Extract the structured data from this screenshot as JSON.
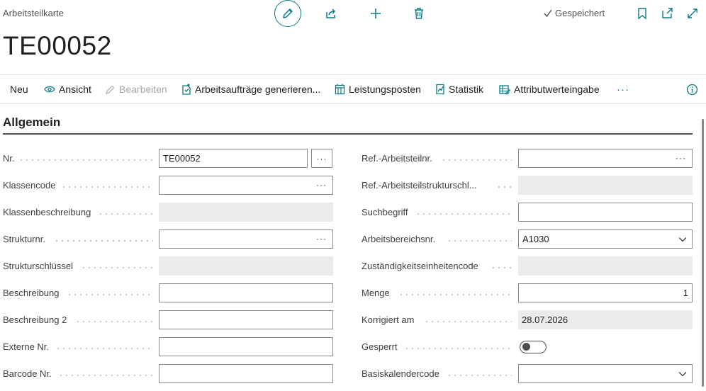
{
  "header": {
    "page_caption": "Arbeitsteilkarte",
    "saved_status": "Gespeichert",
    "record_title": "TE00052"
  },
  "toolbar": {
    "new": "Neu",
    "view": "Ansicht",
    "edit": "Bearbeiten",
    "generate_work_orders": "Arbeitsaufträge generieren...",
    "service_entries": "Leistungsposten",
    "statistics": "Statistik",
    "attribute_entry": "Attributwerteingabe",
    "more": "···"
  },
  "section": {
    "title": "Allgemein"
  },
  "left_fields": [
    {
      "label": "Nr.",
      "value": "TE00052"
    },
    {
      "label": "Klassencode",
      "value": ""
    },
    {
      "label": "Klassenbeschreibung",
      "value": ""
    },
    {
      "label": "Strukturnr.",
      "value": ""
    },
    {
      "label": "Strukturschlüssel",
      "value": ""
    },
    {
      "label": "Beschreibung",
      "value": ""
    },
    {
      "label": "Beschreibung 2",
      "value": ""
    },
    {
      "label": "Externe Nr.",
      "value": ""
    },
    {
      "label": "Barcode Nr.",
      "value": ""
    }
  ],
  "right_fields": [
    {
      "label": "Ref.-Arbeitsteilnr.",
      "value": ""
    },
    {
      "label": "Ref.-Arbeitsteilstrukturschl...",
      "value": ""
    },
    {
      "label": "Suchbegriff",
      "value": ""
    },
    {
      "label": "Arbeitsbereichsnr.",
      "value": "A1030"
    },
    {
      "label": "Zuständigkeitseinheitencode",
      "value": ""
    },
    {
      "label": "Menge",
      "value": "1"
    },
    {
      "label": "Korrigiert am",
      "value": "28.07.2026"
    },
    {
      "label": "Gesperrt",
      "value": "off"
    },
    {
      "label": "Basiskalendercode",
      "value": ""
    }
  ],
  "ellipsis": "···",
  "colors": {
    "accent": "#0a7a8a",
    "readonly_bg": "#ebebeb"
  }
}
